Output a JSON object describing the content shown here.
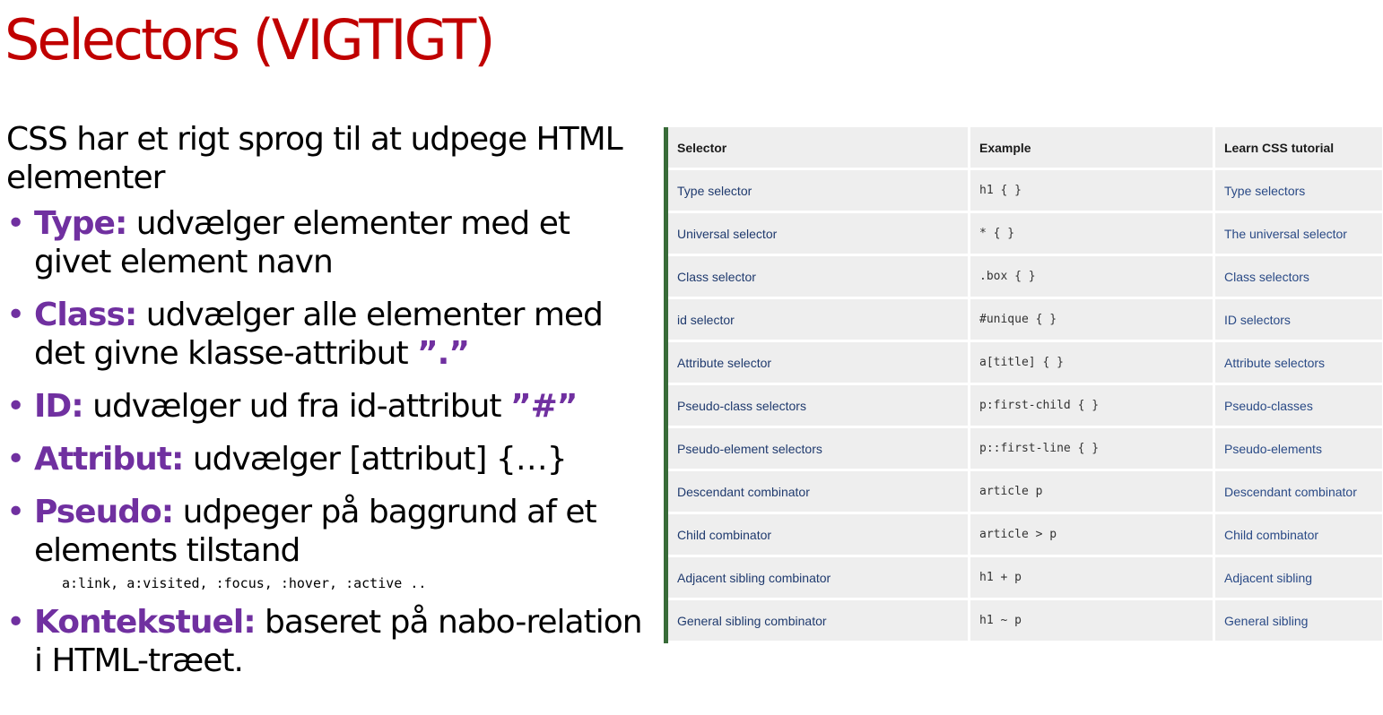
{
  "title": "Selectors (VIGTIGT)",
  "intro": "CSS har et rigt sprog til at udpege HTML elementer",
  "bullets": [
    {
      "keyword": "Type:",
      "text": " udvælger elementer med et givet element navn",
      "symbol": ""
    },
    {
      "keyword": "Class:",
      "text": " udvælger alle elementer med det givne klasse-attribut ",
      "symbol": "”.”"
    },
    {
      "keyword": "ID:",
      "text": " udvælger ud fra id-attribut ",
      "symbol": "”#”"
    },
    {
      "keyword": "Attribut:",
      "text": " udvælger [attribut] {…}",
      "symbol": ""
    },
    {
      "keyword": "Pseudo:",
      "text": " udpeger på baggrund af et elements tilstand",
      "symbol": "",
      "code": "a:link, a:visited, :focus, :hover, :active .."
    },
    {
      "keyword": "Kontekstuel:",
      "text": " baseret på nabo-relation i HTML-træet.",
      "symbol": ""
    }
  ],
  "table": {
    "headers": [
      "Selector",
      "Example",
      "Learn CSS tutorial"
    ],
    "rows": [
      [
        "Type selector",
        "h1 {  }",
        "Type selectors"
      ],
      [
        "Universal selector",
        "* {  }",
        "The universal selector"
      ],
      [
        "Class selector",
        ".box {  }",
        "Class selectors"
      ],
      [
        "id selector",
        "#unique { }",
        "ID selectors"
      ],
      [
        "Attribute selector",
        "a[title] {  }",
        "Attribute selectors"
      ],
      [
        "Pseudo-class selectors",
        "p:first-child { }",
        "Pseudo-classes"
      ],
      [
        "Pseudo-element selectors",
        "p::first-line { }",
        "Pseudo-elements"
      ],
      [
        "Descendant combinator",
        "article p",
        "Descendant combinator"
      ],
      [
        "Child combinator",
        "article > p",
        "Child combinator"
      ],
      [
        "Adjacent sibling combinator",
        "h1 + p",
        "Adjacent sibling"
      ],
      [
        "General sibling combinator",
        "h1 ~ p",
        "General sibling"
      ]
    ]
  },
  "colors": {
    "title": "#c00000",
    "keyword": "#7030a0",
    "table_accent": "#386b38",
    "table_cell_bg": "#eeeeee",
    "link": "#2a4a86"
  },
  "icons": {
    "bullet": "bullet-dot"
  }
}
